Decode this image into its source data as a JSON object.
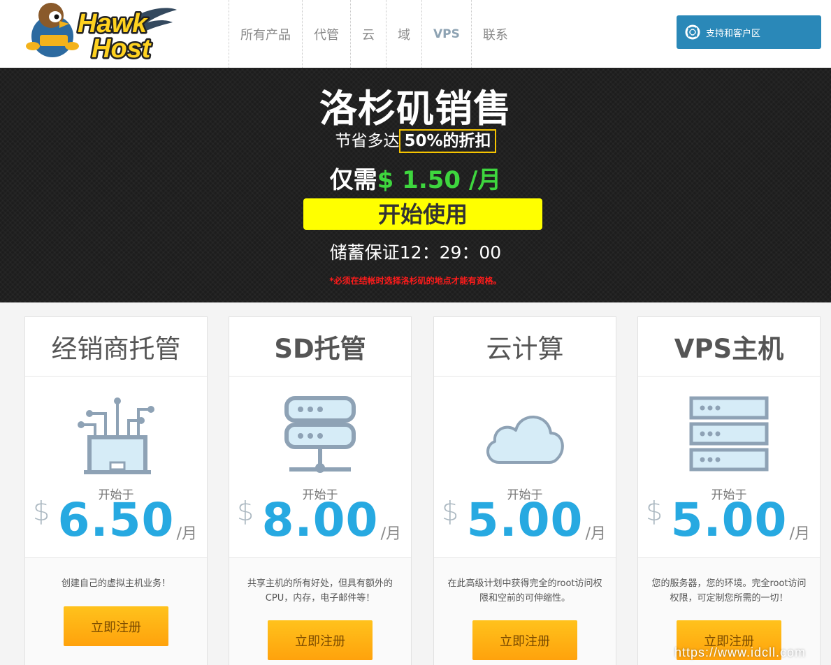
{
  "nav": {
    "items": [
      "所有产品",
      "代管",
      "云",
      "域",
      "VPS",
      "联系"
    ],
    "support_label": "支持和客户区"
  },
  "hero": {
    "title": "洛杉矶销售",
    "discount_prefix": "节省多达",
    "discount_box": "50%的折扣",
    "price_prefix": "仅需",
    "price_value": "$ 1.50 /月",
    "start_label": "开始使用",
    "timer": "储蓄保证12：29：00",
    "note": "*必须在结帐时选择洛杉矶的地点才能有资格。"
  },
  "cards": [
    {
      "title": "经销商托管",
      "icon": "reseller-network-icon",
      "start_label": "开始于",
      "currency": "$",
      "amount": "6.50",
      "per": "/月",
      "desc": "创建自己的虚拟主机业务！",
      "button": "立即注册"
    },
    {
      "title": "SD托管",
      "icon": "server-icon",
      "start_label": "开始于",
      "currency": "$",
      "amount": "8.00",
      "per": "/月",
      "desc": "共享主机的所有好处，但具有额外的CPU，内存，电子邮件等！",
      "button": "立即注册"
    },
    {
      "title": "云计算",
      "icon": "cloud-icon",
      "start_label": "开始于",
      "currency": "$",
      "amount": "5.00",
      "per": "/月",
      "desc": "在此高级计划中获得完全的root访问权限和空前的可伸缩性。",
      "button": "立即注册"
    },
    {
      "title": "VPS主机",
      "icon": "server-rack-icon",
      "start_label": "开始于",
      "currency": "$",
      "amount": "5.00",
      "per": "/月",
      "desc": "您的服务器，您的环境。完全root访问权限，可定制您所需的一切！",
      "button": "立即注册"
    }
  ],
  "watermark": "https://www.idcll.com",
  "colors": {
    "accent_blue": "#27a9e1",
    "support_btn": "#2a88b8",
    "cta_yellow": "#ffff00",
    "order_orange": "#ffb014",
    "price_green": "#3ed63e",
    "note_red": "#ff1b1b"
  }
}
